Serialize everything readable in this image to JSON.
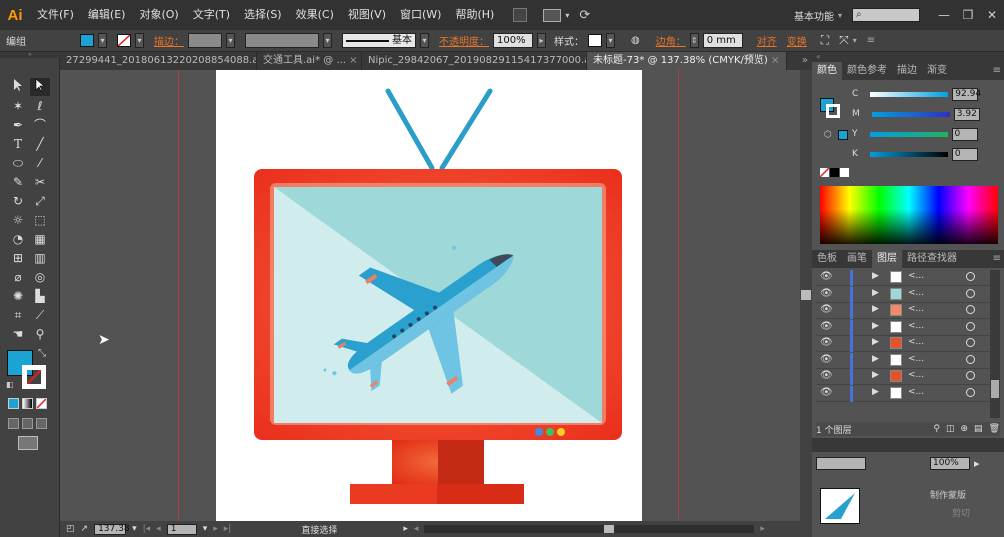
{
  "app": {
    "logo": "Ai"
  },
  "menu": [
    "文件(F)",
    "编辑(E)",
    "对象(O)",
    "文字(T)",
    "选择(S)",
    "效果(C)",
    "视图(V)",
    "窗口(W)",
    "帮助(H)"
  ],
  "workspace": "基本功能",
  "window_controls": [
    "—",
    "❐",
    "✕"
  ],
  "control_bar": {
    "selection": "编组",
    "stroke_label": "描边：",
    "stroke_style": "基本",
    "opacity_label": "不透明度：",
    "opacity_value": "100%",
    "style_label": "样式：",
    "corner_label": "边角：",
    "corner_value": "0 mm",
    "align_label": "对齐",
    "transform_label": "变换"
  },
  "doc_tabs": [
    "27299441_20180613220208854088.ai*",
    "交通工具.ai* @ ...",
    "Nipic_29842067_20190829115417377000.ai*",
    "未标题-73* @ 137.38% (CMYK/预览)"
  ],
  "status": {
    "zoom": "137.38",
    "page": "1",
    "tool": "直接选择"
  },
  "color_panel": {
    "tabs": [
      "颜色",
      "颜色参考",
      "描边",
      "渐变"
    ],
    "channels": [
      {
        "name": "C",
        "value": "92.94"
      },
      {
        "name": "M",
        "value": "3.92"
      },
      {
        "name": "Y",
        "value": "0"
      },
      {
        "name": "K",
        "value": "0"
      }
    ]
  },
  "layers_panel": {
    "tabs": [
      "色板",
      "画笔",
      "图层",
      "路径查找器"
    ],
    "rows": [
      {
        "name": "<...",
        "thumb": "#ffffff"
      },
      {
        "name": "<...",
        "thumb": "#9fd8d8"
      },
      {
        "name": "<...",
        "thumb": "#f28a6a"
      },
      {
        "name": "<...",
        "thumb": "#ffffff"
      },
      {
        "name": "<...",
        "thumb": "#e8502a"
      },
      {
        "name": "<...",
        "thumb": "#ffffff"
      },
      {
        "name": "<...",
        "thumb": "#e8502a"
      },
      {
        "name": "<...",
        "thumb": "#ffffff"
      }
    ],
    "footer": "1 个图层"
  },
  "bottom_panel": {
    "opacity_value": "100%",
    "label": "制作蒙版",
    "partial": "剪切"
  },
  "colors": {
    "fill": "#1aa3d3",
    "tv_frame": "#f0422a",
    "tv_screen": "#9ed8d8",
    "antenna": "#2a9ec9",
    "plane_body": "#2aa0cf",
    "plane_light": "#6ec4e2"
  },
  "icons": [
    "selection-icon",
    "direct-selection-icon",
    "magic-wand-icon",
    "lasso-icon",
    "pen-icon",
    "type-icon",
    "line-icon",
    "ellipse-icon",
    "brush-icon",
    "pencil-icon",
    "rotate-icon",
    "scale-icon",
    "warp-icon",
    "free-transform-icon",
    "shape-builder-icon",
    "gradient-icon",
    "eyedropper-icon",
    "graph-icon",
    "artboard-icon",
    "slice-icon",
    "hand-icon",
    "zoom-icon"
  ]
}
